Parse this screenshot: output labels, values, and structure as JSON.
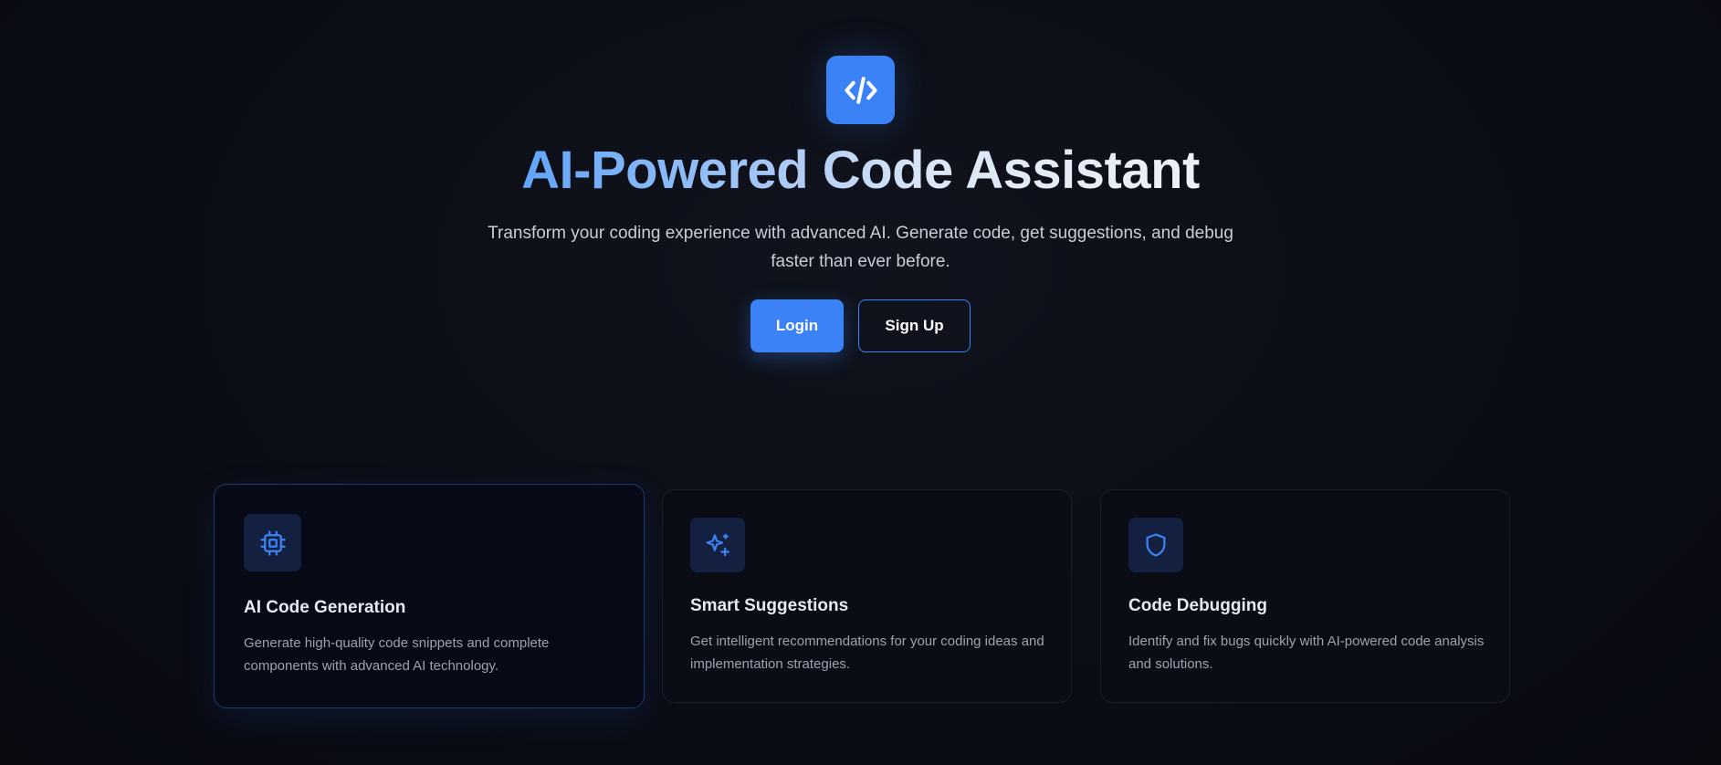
{
  "hero": {
    "logo_icon": "code-brackets-icon",
    "title": "AI-Powered Code Assistant",
    "subtitle": "Transform your coding experience with advanced AI. Generate code, get suggestions, and debug faster than ever before.",
    "login_label": "Login",
    "signup_label": "Sign Up"
  },
  "features": [
    {
      "icon": "cpu-chip-icon",
      "title": "AI Code Generation",
      "description": "Generate high-quality code snippets and complete components with advanced AI technology."
    },
    {
      "icon": "sparkles-icon",
      "title": "Smart Suggestions",
      "description": "Get intelligent recommendations for your coding ideas and implementation strategies."
    },
    {
      "icon": "shield-icon",
      "title": "Code Debugging",
      "description": "Identify and fix bugs quickly with AI-powered code analysis and solutions."
    }
  ],
  "colors": {
    "accent": "#3b82f6",
    "background": "#0b0d15",
    "card_background": "#0a0d16",
    "icon_tile": "#13203f"
  }
}
